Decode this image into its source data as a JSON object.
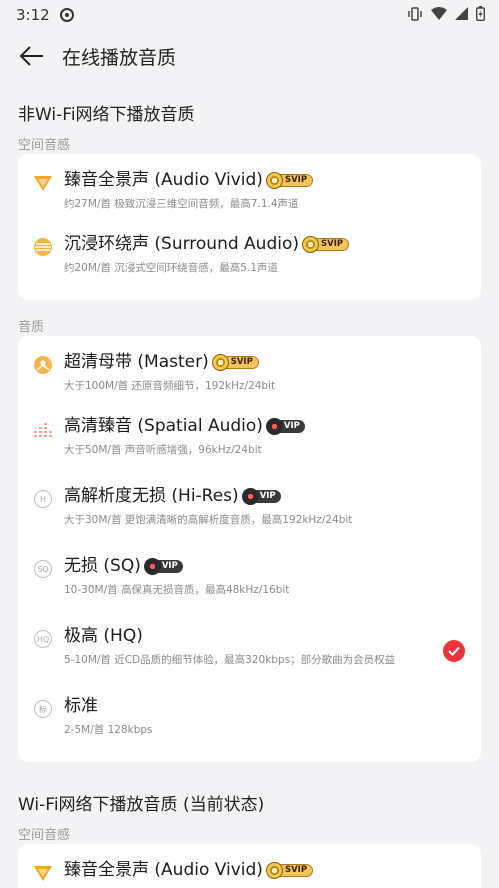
{
  "status": {
    "time": "3:12"
  },
  "header": {
    "title": "在线播放音质"
  },
  "sections": [
    {
      "title": "非Wi-Fi网络下播放音质",
      "groups": [
        {
          "label": "空间音感",
          "items": [
            {
              "title": "臻音全景声 (Audio Vivid)",
              "badge": "SVIP",
              "sub": "约27M/首 极致沉浸三维空间音频，最高7.1.4声道"
            },
            {
              "title": "沉浸环绕声 (Surround Audio)",
              "badge": "SVIP",
              "sub": "约20M/首 沉浸式空间环绕音感，最高5.1声道"
            }
          ]
        },
        {
          "label": "音质",
          "items": [
            {
              "title": "超清母带 (Master)",
              "badge": "SVIP",
              "sub": "大于100M/首 还原音频细节，192kHz/24bit"
            },
            {
              "title": "高清臻音 (Spatial Audio)",
              "badge": "VIP",
              "sub": "大于50M/首 声音听感增强，96kHz/24bit"
            },
            {
              "title": "高解析度无损 (Hi-Res)",
              "badge": "VIP",
              "sub": "大于30M/首 更饱满清晰的高解析度音质，最高192kHz/24bit"
            },
            {
              "title": "无损 (SQ)",
              "badge": "VIP",
              "sub": "10-30M/首 高保真无损音质，最高48kHz/16bit"
            },
            {
              "title": "极高 (HQ)",
              "sub": "5-10M/首 近CD品质的细节体验，最高320kbps；部分歌曲为会员权益",
              "selected": true
            },
            {
              "title": "标准",
              "sub": "2-5M/首 128kbps"
            }
          ]
        }
      ]
    },
    {
      "title": "Wi-Fi网络下播放音质 (当前状态)",
      "groups": [
        {
          "label": "空间音感",
          "items": [
            {
              "title": "臻音全景声 (Audio Vivid)",
              "badge": "SVIP"
            }
          ]
        }
      ]
    }
  ],
  "icon_hints": {
    "SQ": "SQ",
    "HQ": "HQ",
    "H": "H",
    "std": "标"
  },
  "colors": {
    "accent": "#f0343c",
    "svip_gold": "#f2c55c",
    "vip_dark": "#3a3a3a",
    "vivid_orange": "#f5a623"
  }
}
